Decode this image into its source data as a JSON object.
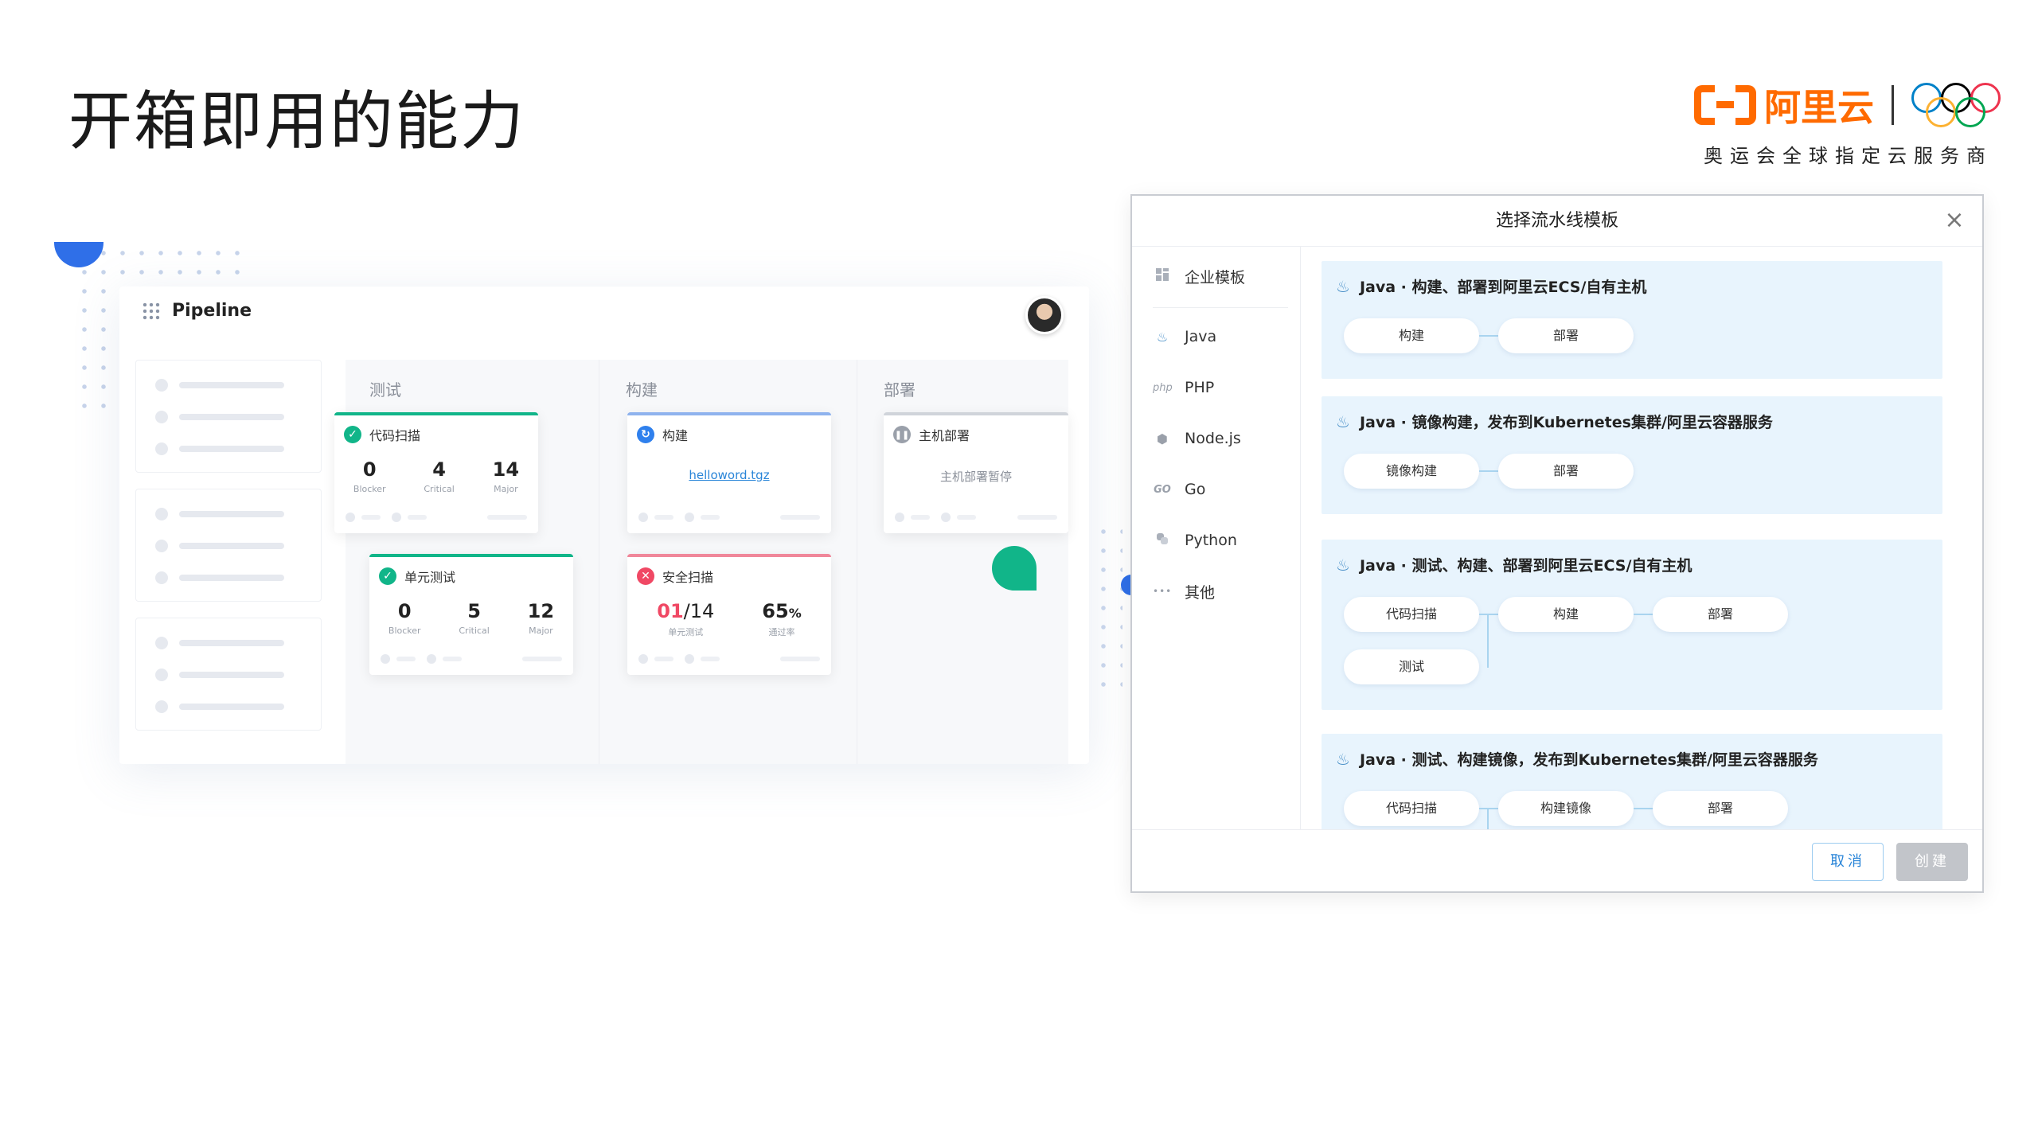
{
  "slide": {
    "title": "开箱即用的能力"
  },
  "brand": {
    "name": "阿里云",
    "subtitle": "奥运会全球指定云服务商"
  },
  "pipeline": {
    "title": "Pipeline",
    "stages": [
      {
        "label": "测试"
      },
      {
        "label": "构建"
      },
      {
        "label": "部署"
      }
    ],
    "jobs": {
      "code_scan": {
        "name": "代码扫描",
        "status_color": "#11b589",
        "metrics": [
          {
            "value": "0",
            "label": "Blocker"
          },
          {
            "value": "4",
            "label": "Critical"
          },
          {
            "value": "14",
            "label": "Major"
          }
        ]
      },
      "unit_test": {
        "name": "单元测试",
        "status_color": "#11b589",
        "metrics": [
          {
            "value": "0",
            "label": "Blocker"
          },
          {
            "value": "5",
            "label": "Critical"
          },
          {
            "value": "12",
            "label": "Major"
          }
        ]
      },
      "build": {
        "name": "构建",
        "status_color": "#2f80ed",
        "artifact": "helloword.tgz"
      },
      "security_scan": {
        "name": "安全扫描",
        "status_color": "#f04864",
        "fail_value": "01",
        "total_value": "/14",
        "fail_label": "单元测试",
        "pass_rate": "65",
        "pass_unit": "%",
        "pass_label": "通过率"
      },
      "host_deploy": {
        "name": "主机部署",
        "status_color": "#9aa0aa",
        "status_text": "主机部署暂停"
      }
    }
  },
  "dialog": {
    "title": "选择流水线模板",
    "close_icon": "×",
    "sidebar": [
      {
        "label": "企业模板",
        "icon": "grid-icon"
      },
      {
        "label": "Java",
        "icon": "java-icon"
      },
      {
        "label": "PHP",
        "icon": "php-icon",
        "icon_text": "php"
      },
      {
        "label": "Node.js",
        "icon": "nodejs-icon"
      },
      {
        "label": "Go",
        "icon": "go-icon",
        "icon_text": "GO"
      },
      {
        "label": "Python",
        "icon": "python-icon"
      },
      {
        "label": "其他",
        "icon": "more-icon",
        "icon_text": "•••"
      }
    ],
    "templates": [
      {
        "title": "Java · 构建、部署到阿里云ECS/自有主机",
        "nodes": [
          "构建",
          "部署"
        ]
      },
      {
        "title": "Java · 镜像构建，发布到Kubernetes集群/阿里云容器服务",
        "nodes": [
          "镜像构建",
          "部署"
        ]
      },
      {
        "title": "Java · 测试、构建、部署到阿里云ECS/自有主机",
        "nodes": [
          "代码扫描",
          "构建",
          "部署",
          "测试"
        ]
      },
      {
        "title": "Java · 测试、构建镜像，发布到Kubernetes集群/阿里云容器服务",
        "nodes": [
          "代码扫描",
          "构建镜像",
          "部署"
        ]
      }
    ],
    "buttons": {
      "cancel": "取消",
      "create": "创建"
    }
  },
  "colors": {
    "brand": "#ff6a00",
    "accent": "#2a85d8",
    "template_bg": "#e8f4fd"
  }
}
